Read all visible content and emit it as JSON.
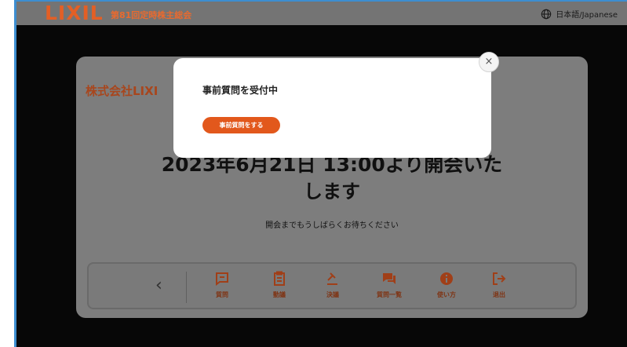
{
  "header": {
    "logo": "LIXIL",
    "event_title": "第81回定時株主総会",
    "language": "日本語/Japanese",
    "language_icon": "globe-icon"
  },
  "card": {
    "company": "株式会社LIXI",
    "announce_line1": "2023年6月21日 13:00より開会いた",
    "announce_line2": "します",
    "sub": "開会までもうしばらくお待ちください"
  },
  "nav": {
    "back_icon": "chevron-left-icon",
    "items": [
      {
        "label": "質問",
        "icon": "chat-square-icon"
      },
      {
        "label": "動議",
        "icon": "clipboard-icon"
      },
      {
        "label": "決議",
        "icon": "gavel-icon"
      },
      {
        "label": "質問一覧",
        "icon": "chat-list-icon"
      },
      {
        "label": "使い方",
        "icon": "info-icon"
      },
      {
        "label": "退出",
        "icon": "logout-icon"
      }
    ]
  },
  "modal": {
    "title": "事前質問を受付中",
    "button": "事前質問をする",
    "close_glyph": "×"
  },
  "colors": {
    "accent": "#e2581c",
    "logo": "#e35f25",
    "page_border": "#3d8ed0"
  }
}
